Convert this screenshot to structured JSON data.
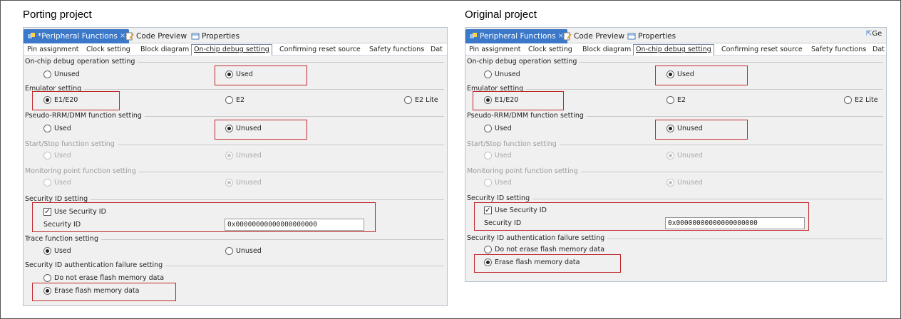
{
  "captions": {
    "left": "Porting project",
    "right": "Original project"
  },
  "tabs": {
    "peripheral_left": "*Peripheral Functions",
    "peripheral_right": "Peripheral Functions",
    "close": "×",
    "code_preview": "Code Preview",
    "properties": "Properties",
    "ge": "Ge"
  },
  "subtabs": [
    "Pin assignment",
    "Clock setting",
    "Block diagram",
    "On-chip debug setting",
    "Confirming reset source",
    "Safety functions",
    "Dat"
  ],
  "groups": {
    "onchip": "On-chip debug operation setting",
    "emulator": "Emulator setting",
    "pseudo": "Pseudo-RRM/DMM function setting",
    "startstop": "Start/Stop function setting",
    "monitor": "Monitoring point function setting",
    "secid": "Security ID setting",
    "trace": "Trace function setting",
    "secfail": "Security ID authentication failure setting"
  },
  "options": {
    "unused": "Unused",
    "used": "Used",
    "e1e20": "E1/E20",
    "e2": "E2",
    "e2lite": "E2 Lite",
    "use_secid": "Use Security ID",
    "secid_label": "Security ID",
    "secid_value": "0x00000000000000000000",
    "no_erase": "Do not erase flash memory data",
    "erase": "Erase flash memory data"
  },
  "colors": {
    "accent": "#3b78c9",
    "highlight": "#c0282d"
  }
}
